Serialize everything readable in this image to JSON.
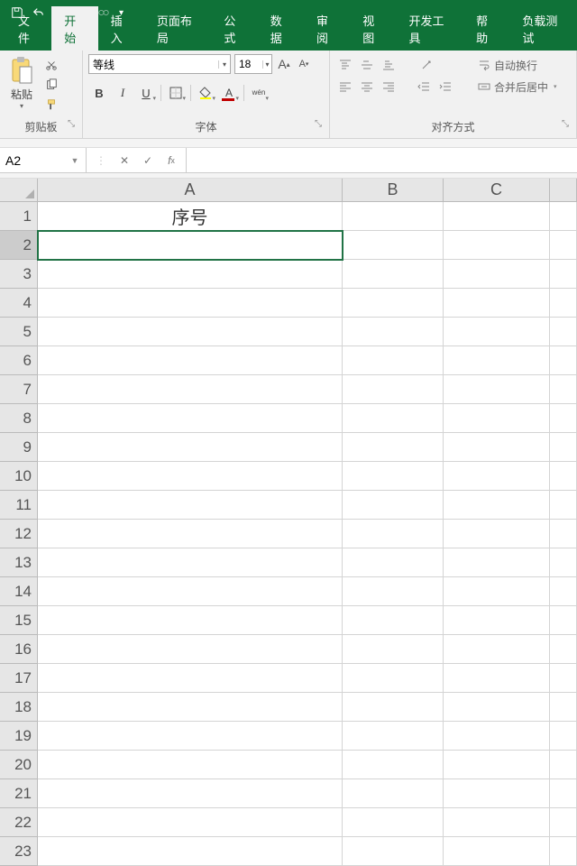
{
  "tabs": {
    "file": "文件",
    "home": "开始",
    "insert": "插入",
    "layout": "页面布局",
    "formula": "公式",
    "data": "数据",
    "review": "审阅",
    "view": "视图",
    "dev": "开发工具",
    "help": "帮助",
    "load": "负载测试"
  },
  "clipboard": {
    "paste": "粘贴",
    "label": "剪贴板"
  },
  "font": {
    "name": "等线",
    "size": "18",
    "label": "字体",
    "wen": "wén"
  },
  "align": {
    "wrap": "自动换行",
    "merge": "合并后居中",
    "label": "对齐方式"
  },
  "namebox": "A2",
  "columns": [
    "A",
    "B",
    "C",
    ""
  ],
  "rows": [
    {
      "n": "1",
      "cells": [
        "序号",
        "",
        "",
        ""
      ]
    },
    {
      "n": "2",
      "cells": [
        "",
        "",
        "",
        ""
      ],
      "sel": true
    },
    {
      "n": "3",
      "cells": [
        "",
        "",
        "",
        ""
      ]
    },
    {
      "n": "4",
      "cells": [
        "",
        "",
        "",
        ""
      ]
    },
    {
      "n": "5",
      "cells": [
        "",
        "",
        "",
        ""
      ]
    },
    {
      "n": "6",
      "cells": [
        "",
        "",
        "",
        ""
      ]
    },
    {
      "n": "7",
      "cells": [
        "",
        "",
        "",
        ""
      ]
    },
    {
      "n": "8",
      "cells": [
        "",
        "",
        "",
        ""
      ]
    },
    {
      "n": "9",
      "cells": [
        "",
        "",
        "",
        ""
      ]
    },
    {
      "n": "10",
      "cells": [
        "",
        "",
        "",
        ""
      ]
    },
    {
      "n": "11",
      "cells": [
        "",
        "",
        "",
        ""
      ]
    },
    {
      "n": "12",
      "cells": [
        "",
        "",
        "",
        ""
      ]
    },
    {
      "n": "13",
      "cells": [
        "",
        "",
        "",
        ""
      ]
    },
    {
      "n": "14",
      "cells": [
        "",
        "",
        "",
        ""
      ]
    },
    {
      "n": "15",
      "cells": [
        "",
        "",
        "",
        ""
      ]
    },
    {
      "n": "16",
      "cells": [
        "",
        "",
        "",
        ""
      ]
    },
    {
      "n": "17",
      "cells": [
        "",
        "",
        "",
        ""
      ]
    },
    {
      "n": "18",
      "cells": [
        "",
        "",
        "",
        ""
      ]
    },
    {
      "n": "19",
      "cells": [
        "",
        "",
        "",
        ""
      ]
    },
    {
      "n": "20",
      "cells": [
        "",
        "",
        "",
        ""
      ]
    },
    {
      "n": "21",
      "cells": [
        "",
        "",
        "",
        ""
      ]
    },
    {
      "n": "22",
      "cells": [
        "",
        "",
        "",
        ""
      ]
    },
    {
      "n": "23",
      "cells": [
        "",
        "",
        "",
        ""
      ]
    }
  ]
}
